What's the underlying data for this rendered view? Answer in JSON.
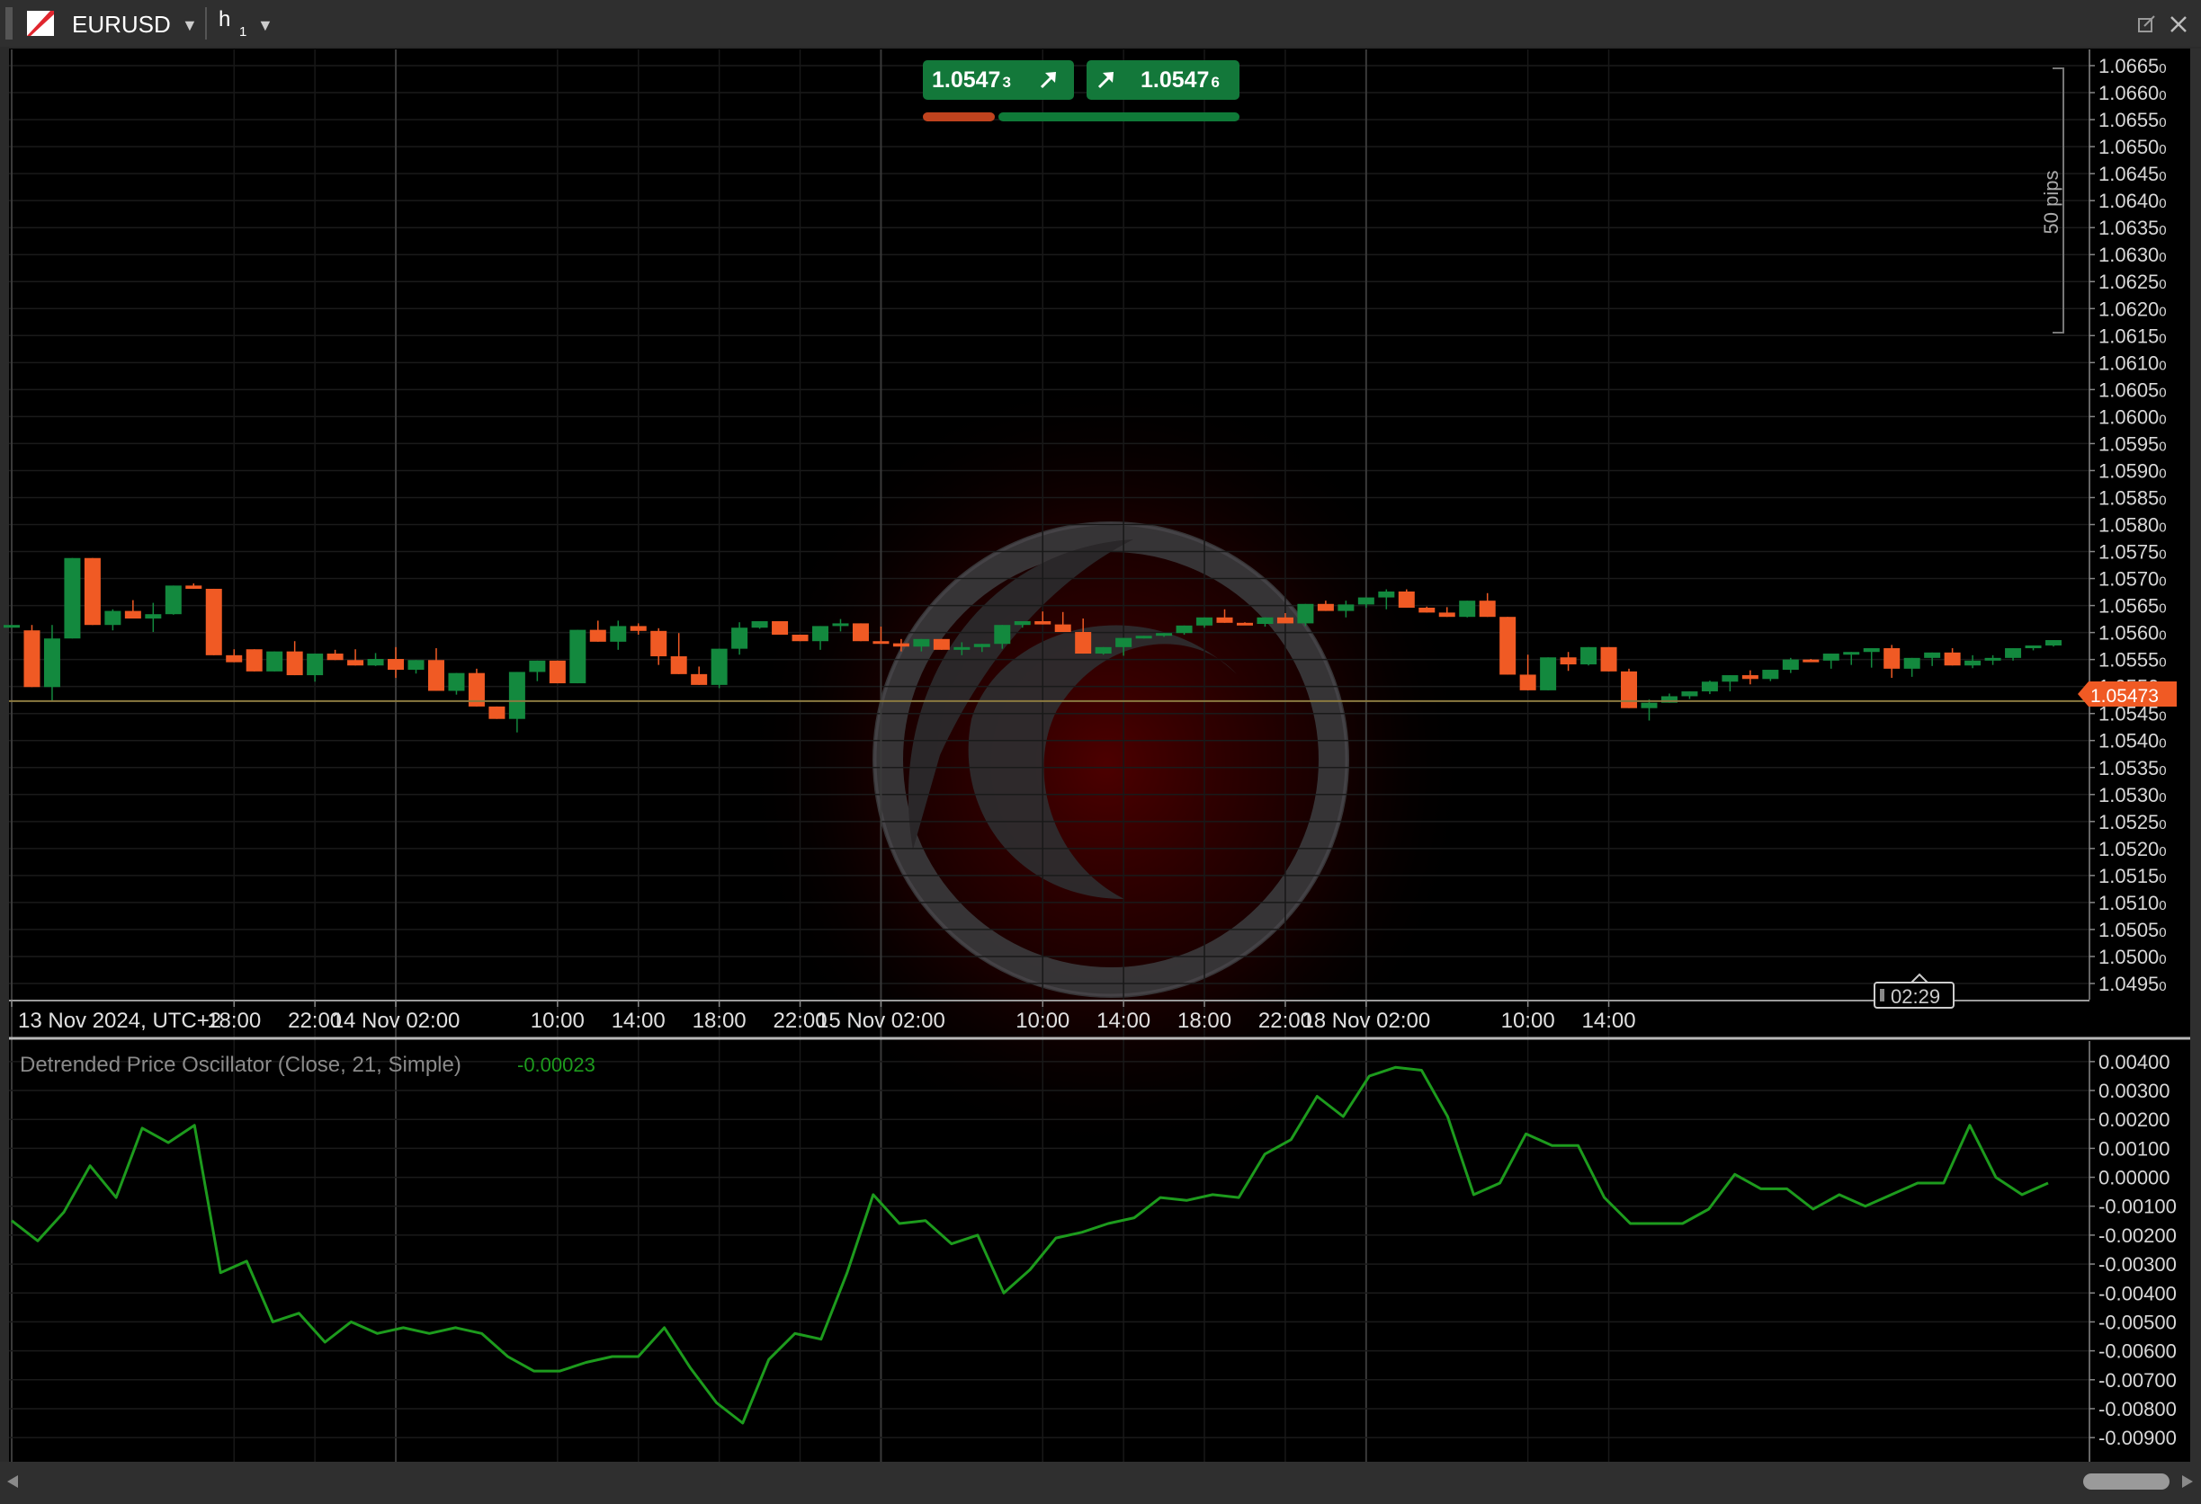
{
  "toolbar": {
    "symbol": "EURUSD",
    "timeframe": "h",
    "timeframe_sub": "1"
  },
  "quote": {
    "sell_main": "1.0547",
    "sell_pip": "3",
    "buy_main": "1.0547",
    "buy_pip": "6"
  },
  "price_axis": {
    "current_price": "1.05473",
    "range_label": "50 pips",
    "countdown": "02:29"
  },
  "indicator": {
    "name": "Detrended Price Oscillator (Close, 21, Simple)",
    "value": "-0.00023"
  },
  "colors": {
    "bull": "#13893e",
    "bear": "#f05a24",
    "indicator": "#1d9b1d",
    "price_line": "#8b7a40"
  },
  "chart_data": [
    {
      "type": "candlestick",
      "time_labels": [
        "13 Nov 2024, UTC+2",
        "18:00",
        "22:00",
        "14 Nov 02:00",
        "10:00",
        "14:00",
        "18:00",
        "22:00",
        "15 Nov 02:00",
        "10:00",
        "14:00",
        "18:00",
        "22:00",
        "18 Nov 02:00",
        "10:00",
        "14:00"
      ],
      "y_ticks": [
        "1.0665",
        "1.0660",
        "1.0655",
        "1.0650",
        "1.0645",
        "1.0640",
        "1.0635",
        "1.0630",
        "1.0625",
        "1.0620",
        "1.0615",
        "1.0610",
        "1.0605",
        "1.0600",
        "1.0595",
        "1.0590",
        "1.0585",
        "1.0580",
        "1.0575",
        "1.0570",
        "1.0565",
        "1.0560",
        "1.0555",
        "1.0550",
        "1.0545",
        "1.0540",
        "1.0535",
        "1.0530",
        "1.0525",
        "1.0520",
        "1.0515",
        "1.0510",
        "1.0505",
        "1.0500",
        "1.0495"
      ],
      "y_tick_suffix": "0",
      "ylim": [
        1.0492,
        1.0668
      ],
      "ohlc": [
        [
          1.05614,
          1.05614,
          1.05614,
          1.05614
        ],
        [
          1.05604,
          1.05614,
          1.05499,
          1.05499
        ],
        [
          1.05499,
          1.05614,
          1.05473,
          1.05589
        ],
        [
          1.05589,
          1.05717,
          1.05589,
          1.05738
        ],
        [
          1.05738,
          1.05738,
          1.05614,
          1.05614
        ],
        [
          1.05614,
          1.05643,
          1.05604,
          1.0564
        ],
        [
          1.0564,
          1.05644,
          1.0566,
          1.05626
        ],
        [
          1.05626,
          1.05655,
          1.05601,
          1.05634
        ],
        [
          1.05634,
          1.05634,
          1.05633,
          1.05687
        ],
        [
          1.05687,
          1.05691,
          1.05681,
          1.05681
        ],
        [
          1.05681,
          1.05681,
          1.05558,
          1.05558
        ],
        [
          1.05558,
          1.05569,
          1.05545,
          1.05545
        ],
        [
          1.05569,
          1.05569,
          1.05528,
          1.05528
        ],
        [
          1.05528,
          1.05565,
          1.05528,
          1.05565
        ],
        [
          1.05565,
          1.05584,
          1.05521,
          1.05521
        ],
        [
          1.05521,
          1.05561,
          1.05509,
          1.05561
        ],
        [
          1.05561,
          1.05568,
          1.05549,
          1.05549
        ],
        [
          1.05549,
          1.05569,
          1.05539,
          1.05539
        ],
        [
          1.05539,
          1.05562,
          1.05538,
          1.05551
        ],
        [
          1.05551,
          1.05573,
          1.05516,
          1.05531
        ],
        [
          1.05531,
          1.05545,
          1.05524,
          1.05549
        ],
        [
          1.05549,
          1.05571,
          1.05492,
          1.05492
        ],
        [
          1.05492,
          1.05525,
          1.05485,
          1.05525
        ],
        [
          1.05525,
          1.05533,
          1.05463,
          1.05463
        ],
        [
          1.05463,
          1.05463,
          1.0544,
          1.0544
        ],
        [
          1.0544,
          1.05527,
          1.05415,
          1.05527
        ],
        [
          1.05527,
          1.05548,
          1.0551,
          1.05548
        ],
        [
          1.05548,
          1.05548,
          1.05506,
          1.05506
        ],
        [
          1.05506,
          1.05605,
          1.05506,
          1.05605
        ],
        [
          1.05605,
          1.05622,
          1.05583,
          1.05583
        ],
        [
          1.05583,
          1.05622,
          1.05568,
          1.05612
        ],
        [
          1.05612,
          1.05617,
          1.05596,
          1.05603
        ],
        [
          1.05603,
          1.05608,
          1.0554,
          1.05556
        ],
        [
          1.05556,
          1.05599,
          1.05523,
          1.05523
        ],
        [
          1.05523,
          1.05537,
          1.05503,
          1.05503
        ],
        [
          1.05503,
          1.0557,
          1.05497,
          1.0557
        ],
        [
          1.0557,
          1.05619,
          1.05559,
          1.05609
        ],
        [
          1.05609,
          1.05621,
          1.05607,
          1.05621
        ],
        [
          1.05621,
          1.05621,
          1.05596,
          1.05596
        ],
        [
          1.05596,
          1.05596,
          1.05584,
          1.05584
        ],
        [
          1.05584,
          1.05612,
          1.05568,
          1.05612
        ],
        [
          1.05612,
          1.05625,
          1.05602,
          1.05617
        ],
        [
          1.05617,
          1.05617,
          1.05584,
          1.05584
        ],
        [
          1.05584,
          1.05611,
          1.0558,
          1.0558
        ],
        [
          1.0558,
          1.05588,
          1.05565,
          1.05574
        ],
        [
          1.05574,
          1.05588,
          1.05565,
          1.05588
        ],
        [
          1.05588,
          1.05588,
          1.05568,
          1.05568
        ],
        [
          1.05568,
          1.05582,
          1.05558,
          1.05573
        ],
        [
          1.05573,
          1.05579,
          1.05564,
          1.05579
        ],
        [
          1.05579,
          1.05614,
          1.0557,
          1.05614
        ],
        [
          1.05614,
          1.05621,
          1.05609,
          1.05621
        ],
        [
          1.05621,
          1.05639,
          1.05615,
          1.05615
        ],
        [
          1.05615,
          1.05638,
          1.05601,
          1.05601
        ],
        [
          1.05601,
          1.05626,
          1.05561,
          1.05561
        ],
        [
          1.05561,
          1.05573,
          1.05559,
          1.05573
        ],
        [
          1.05573,
          1.0559,
          1.05557,
          1.0559
        ],
        [
          1.0559,
          1.05594,
          1.05589,
          1.05594
        ],
        [
          1.05594,
          1.05599,
          1.05592,
          1.05599
        ],
        [
          1.05599,
          1.05613,
          1.05596,
          1.05613
        ],
        [
          1.05613,
          1.05628,
          1.05609,
          1.05628
        ],
        [
          1.05628,
          1.05643,
          1.05618,
          1.05618
        ],
        [
          1.05618,
          1.05619,
          1.05616,
          1.05616
        ],
        [
          1.05616,
          1.05628,
          1.05611,
          1.05628
        ],
        [
          1.05628,
          1.05636,
          1.05617,
          1.05617
        ],
        [
          1.05617,
          1.05653,
          1.05612,
          1.05653
        ],
        [
          1.05653,
          1.05659,
          1.0564,
          1.0564
        ],
        [
          1.0564,
          1.05659,
          1.05628,
          1.05652
        ],
        [
          1.05652,
          1.05665,
          1.05646,
          1.05665
        ],
        [
          1.05665,
          1.0568,
          1.05643,
          1.05676
        ],
        [
          1.05676,
          1.0568,
          1.05646,
          1.05646
        ],
        [
          1.05646,
          1.05648,
          1.05637,
          1.05637
        ],
        [
          1.05637,
          1.05647,
          1.05629,
          1.05629
        ],
        [
          1.05629,
          1.05659,
          1.05628,
          1.05659
        ],
        [
          1.05659,
          1.05673,
          1.05629,
          1.05629
        ],
        [
          1.05629,
          1.05629,
          1.05522,
          1.05522
        ],
        [
          1.05522,
          1.05559,
          1.05493,
          1.05493
        ],
        [
          1.05493,
          1.05554,
          1.05493,
          1.05554
        ],
        [
          1.05554,
          1.05564,
          1.05529,
          1.05541
        ],
        [
          1.05541,
          1.05573,
          1.05539,
          1.05573
        ],
        [
          1.05573,
          1.05573,
          1.05528,
          1.05528
        ],
        [
          1.05528,
          1.05533,
          1.0546,
          1.0546
        ],
        [
          1.0546,
          1.05476,
          1.05437,
          1.0547
        ],
        [
          1.0547,
          1.05487,
          1.0547,
          1.05482
        ],
        [
          1.05482,
          1.05491,
          1.05477,
          1.05491
        ],
        [
          1.05491,
          1.05511,
          1.05486,
          1.05509
        ],
        [
          1.05509,
          1.05521,
          1.05491,
          1.05521
        ],
        [
          1.05521,
          1.0553,
          1.05504,
          1.05514
        ],
        [
          1.05514,
          1.05531,
          1.0551,
          1.05531
        ],
        [
          1.05531,
          1.05553,
          1.05525,
          1.0555
        ],
        [
          1.0555,
          1.05551,
          1.05548,
          1.05548
        ],
        [
          1.05548,
          1.05561,
          1.05533,
          1.05561
        ],
        [
          1.05561,
          1.05564,
          1.0554,
          1.05564
        ],
        [
          1.05564,
          1.05571,
          1.05535,
          1.05571
        ],
        [
          1.05571,
          1.05577,
          1.05516,
          1.05533
        ],
        [
          1.05533,
          1.05553,
          1.05518,
          1.05553
        ],
        [
          1.05553,
          1.05563,
          1.05538,
          1.05563
        ],
        [
          1.05563,
          1.05571,
          1.05539,
          1.05539
        ],
        [
          1.05539,
          1.05558,
          1.05534,
          1.05548
        ],
        [
          1.05548,
          1.05558,
          1.0554,
          1.05553
        ],
        [
          1.05553,
          1.05571,
          1.05548,
          1.05571
        ],
        [
          1.05571,
          1.05576,
          1.05567,
          1.05576
        ],
        [
          1.05576,
          1.05586,
          1.05574,
          1.05586
        ]
      ]
    },
    {
      "type": "line",
      "title": "Detrended Price Oscillator (Close, 21, Simple)",
      "y_ticks": [
        "0.00400",
        "0.00300",
        "0.00200",
        "0.00100",
        "0.00000",
        "-0.00100",
        "-0.00200",
        "-0.00300",
        "-0.00400",
        "-0.00500",
        "-0.00600",
        "-0.00700",
        "-0.00800",
        "-0.00900"
      ],
      "ylim": [
        -0.0094,
        0.0044
      ],
      "series": [
        {
          "values": [
            -0.0015,
            -0.0022,
            -0.0012,
            0.0004,
            -0.0007,
            0.0017,
            0.0012,
            0.0018,
            -0.0033,
            -0.0029,
            -0.005,
            -0.0047,
            -0.0057,
            -0.005,
            -0.0054,
            -0.0052,
            -0.0054,
            -0.0052,
            -0.0054,
            -0.0062,
            -0.0067,
            -0.0067,
            -0.0064,
            -0.0062,
            -0.0062,
            -0.0052,
            -0.0066,
            -0.0078,
            -0.0085,
            -0.0063,
            -0.0054,
            -0.0056,
            -0.0033,
            -0.0006,
            -0.0016,
            -0.0015,
            -0.0023,
            -0.002,
            -0.004,
            -0.0032,
            -0.0021,
            -0.0019,
            -0.0016,
            -0.0014,
            -0.0007,
            -0.0008,
            -0.0006,
            -0.0007,
            0.0008,
            0.0013,
            0.0028,
            0.0021,
            0.0035,
            0.0038,
            0.0037,
            0.0021,
            -0.0006,
            -0.0002,
            0.0015,
            0.0011,
            0.0011,
            -0.0007,
            -0.0016,
            -0.0016,
            -0.0016,
            -0.0011,
            0.0001,
            -0.0004,
            -0.0004,
            -0.0011,
            -0.0006,
            -0.001,
            -0.0006,
            -0.0002,
            -0.0002,
            0.0018,
            0.0,
            -0.0006,
            -0.0002
          ]
        }
      ]
    }
  ]
}
